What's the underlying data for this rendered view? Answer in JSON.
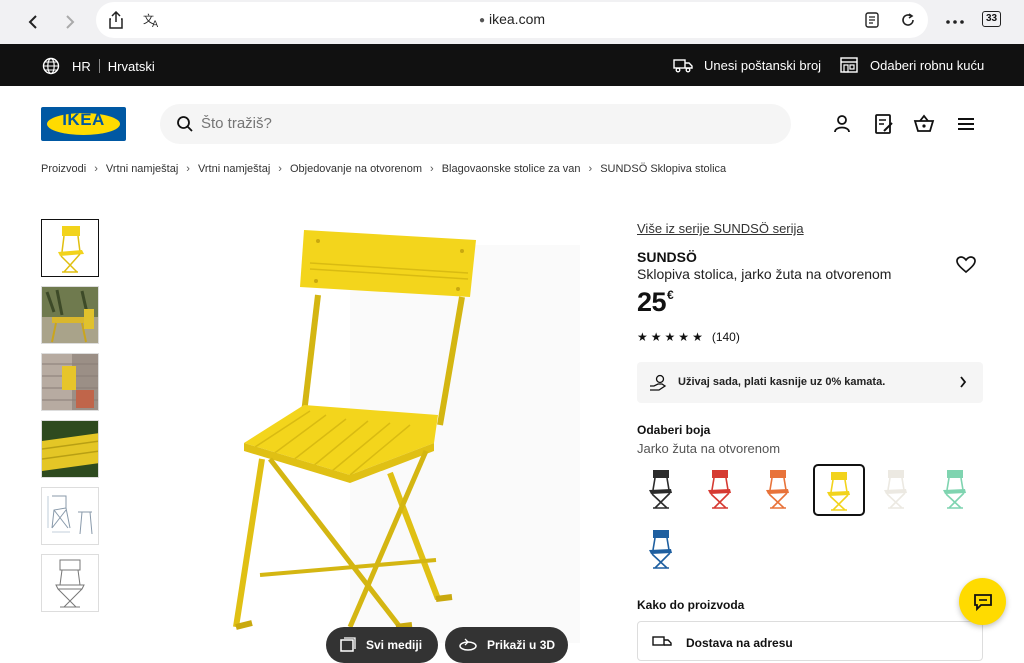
{
  "browser": {
    "url": "ikea.com",
    "tab_count": "33"
  },
  "top_strip": {
    "lang_code": "HR",
    "lang_name": "Hrvatski",
    "postal": "Unesi poštanski broj",
    "store": "Odaberi robnu kuću"
  },
  "header": {
    "logo_text": "IKEA",
    "search_placeholder": "Što tražiš?"
  },
  "breadcrumb": [
    "Proizvodi",
    "Vrtni namještaj",
    "Vrtni namještaj",
    "Objedovanje na otvorenom",
    "Blagovaonske stolice za van",
    "SUNDSÖ Sklopiva stolica"
  ],
  "gallery": {
    "btn_all_media": "Svi mediji",
    "btn_3d": "Prikaži u 3D"
  },
  "product": {
    "series_link": "Više iz serije SUNDSÖ serija",
    "name": "SUNDSÖ",
    "description": "Sklopiva stolica, jarko žuta na otvorenom",
    "price": "25",
    "currency": "€",
    "rating": 5,
    "review_count": "(140)",
    "pay_later": "Uživaj sada, plati kasnije uz 0% kamata.",
    "color_title": "Odaberi boja",
    "color_value": "Jarko žuta na otvorenom",
    "swatches": [
      {
        "name": "black",
        "color": "#2b2b2b"
      },
      {
        "name": "red",
        "color": "#d63a32"
      },
      {
        "name": "orange",
        "color": "#e8733a"
      },
      {
        "name": "yellow",
        "color": "#f2d31b",
        "selected": true
      },
      {
        "name": "white",
        "color": "#ece9e2"
      },
      {
        "name": "mint",
        "color": "#7fd4b0"
      },
      {
        "name": "blue",
        "color": "#1e5fa0"
      }
    ],
    "delivery_title": "Kako do proizvoda",
    "delivery_option": "Dostava na adresu"
  },
  "colors": {
    "ikea_blue": "#0058a3",
    "ikea_yellow": "#ffdb00",
    "chair_yellow": "#f2d31b"
  }
}
